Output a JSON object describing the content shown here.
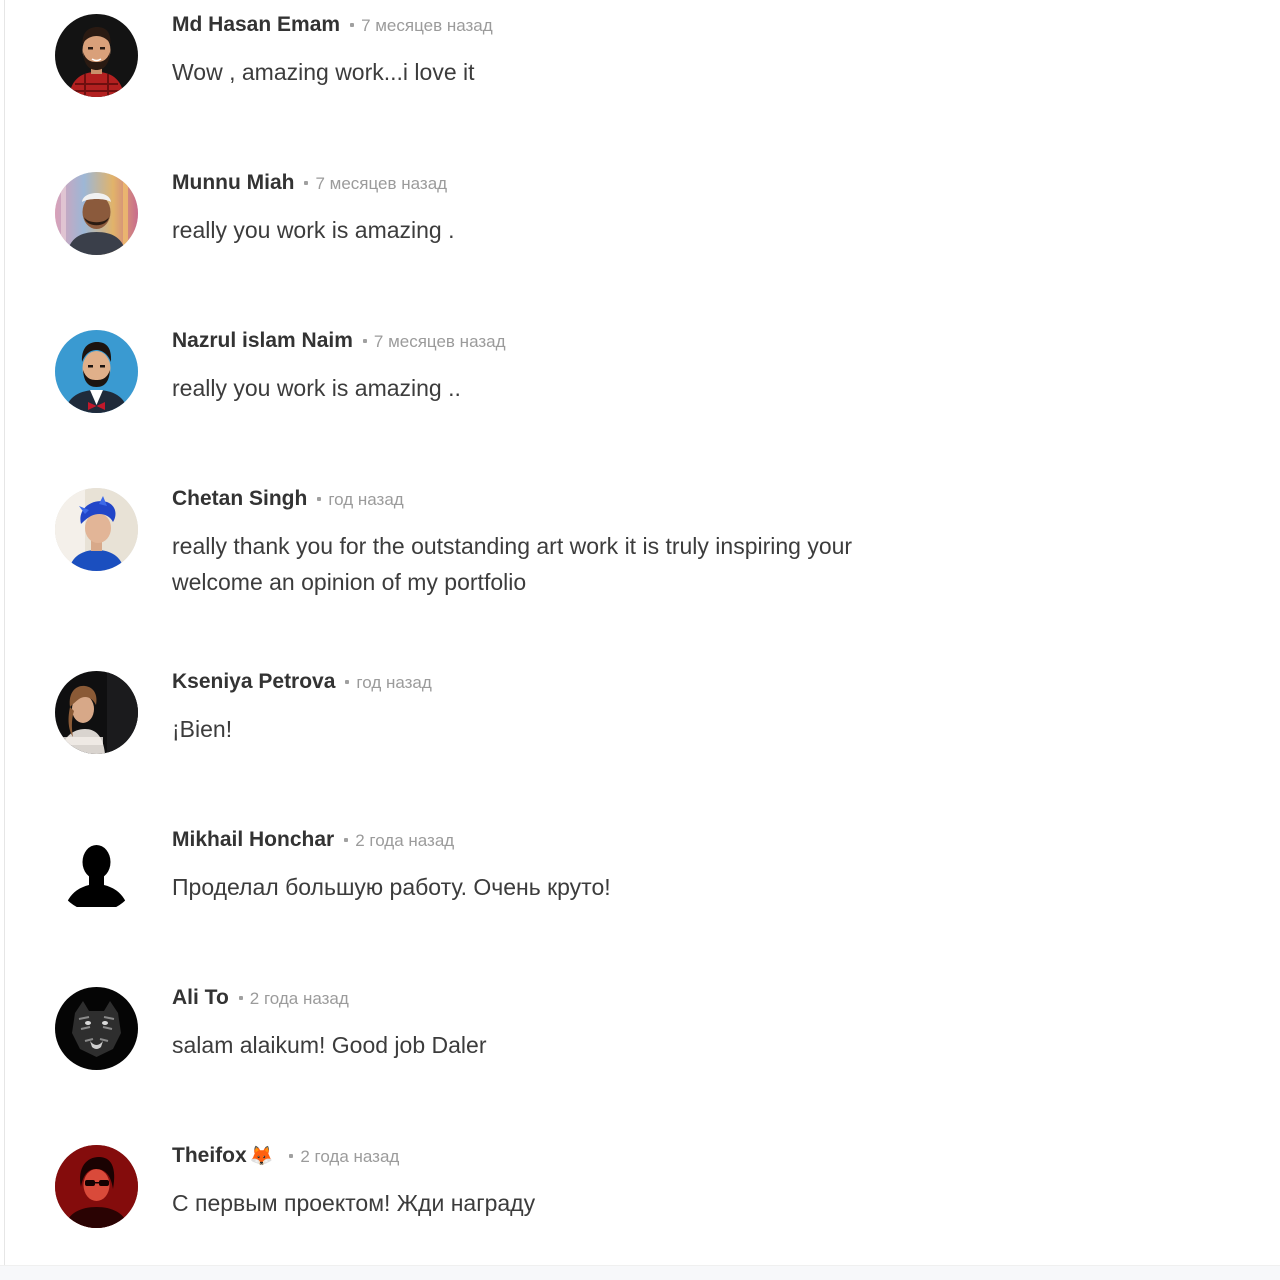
{
  "comments": [
    {
      "author": "Md Hasan Emam",
      "time": "7 месяцев назад",
      "text": "Wow , amazing work...i love it",
      "avatar": "cartoon-bearded-man-red-shirt"
    },
    {
      "author": "Munnu Miah",
      "time": "7 месяцев назад",
      "text": "really you work is amazing .",
      "avatar": "photo-man-cap"
    },
    {
      "author": "Nazrul islam Naim",
      "time": "7 месяцев назад",
      "text": "really you work is amazing ..",
      "avatar": "cartoon-man-bowtie"
    },
    {
      "author": "Chetan Singh",
      "time": "год назад",
      "text": "really thank you for the outstanding art work it is truly inspiring your welcome an opinion of my portfolio",
      "avatar": "photo-man-blue-hair"
    },
    {
      "author": "Kseniya Petrova",
      "time": "год назад",
      "text": "¡Bien!",
      "avatar": "photo-woman-dark"
    },
    {
      "author": "Mikhail Honchar",
      "time": "2 года назад",
      "text": "Проделал большую работу. Очень круто!",
      "avatar": "silhouette"
    },
    {
      "author": "Ali To",
      "time": "2 года назад",
      "text": "salam alaikum! Good job Daler",
      "avatar": "tiger-dark"
    },
    {
      "author": "Theifox",
      "author_emoji": "🦊",
      "time": "2 года назад",
      "text": "С первым проектом! Жди награду",
      "avatar": "photo-woman-red"
    }
  ],
  "colors": {
    "author": "#333333",
    "time": "#9b9b9b",
    "text": "#3c3c3c",
    "separator": "#a0a0a0"
  }
}
